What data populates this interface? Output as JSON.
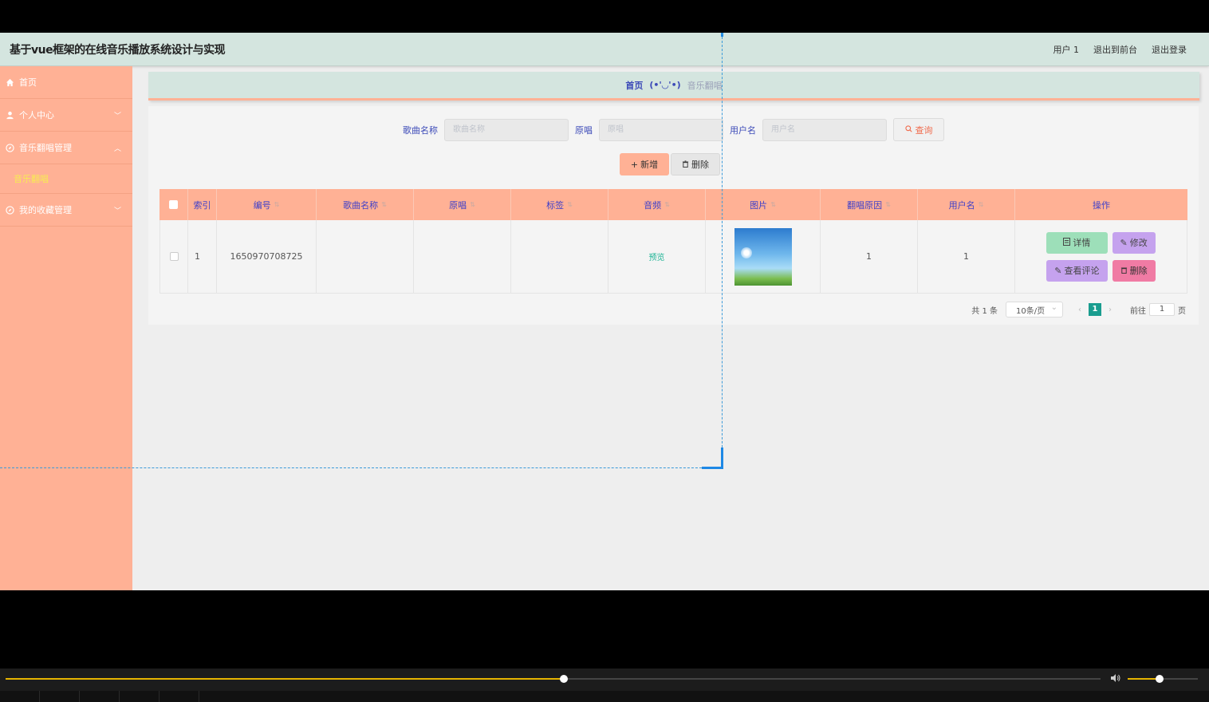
{
  "header": {
    "title": "基于vue框架的在线音乐播放系统设计与实现",
    "user_label": "用户 1",
    "back_to_front": "退出到前台",
    "logout": "退出登录"
  },
  "sidebar": {
    "items": [
      {
        "label": "首页",
        "icon": "home-icon"
      },
      {
        "label": "个人中心",
        "icon": "user-icon"
      },
      {
        "label": "音乐翻唱管理",
        "icon": "compass-icon"
      },
      {
        "label": "我的收藏管理",
        "icon": "compass-icon"
      }
    ],
    "sub_item": "音乐翻唱"
  },
  "breadcrumb": {
    "home": "首页",
    "separator": "(•'◡'•)",
    "current": "音乐翻唱"
  },
  "search": {
    "song_label": "歌曲名称",
    "song_placeholder": "歌曲名称",
    "original_label": "原唱",
    "original_placeholder": "原唱",
    "user_label": "用户名",
    "user_placeholder": "用户名",
    "query_button": "查询"
  },
  "actions": {
    "add": "新增",
    "delete": "删除"
  },
  "table": {
    "columns": [
      "索引",
      "编号",
      "歌曲名称",
      "原唱",
      "标签",
      "音频",
      "图片",
      "翻唱原因",
      "用户名",
      "操作"
    ],
    "rows": [
      {
        "index": "1",
        "id": "1650970708725",
        "song": "",
        "original": "",
        "tag": "",
        "audio": "预览",
        "reason": "1",
        "username": "1"
      }
    ],
    "row_actions": {
      "detail": "详情",
      "edit": "修改",
      "comments": "查看评论",
      "remove": "删除"
    }
  },
  "pagination": {
    "total": "共 1 条",
    "page_size": "10条/页",
    "current_page": "1",
    "goto_label": "前往",
    "goto_value": "1",
    "page_suffix": "页"
  },
  "player": {
    "progress": 0.51,
    "volume": 0.45
  },
  "colors": {
    "accent": "#ffb195",
    "header_bg": "#d4e5df",
    "header_text": "#4040c8",
    "page_active": "#1a9d8f",
    "seek": "#e6b400"
  }
}
